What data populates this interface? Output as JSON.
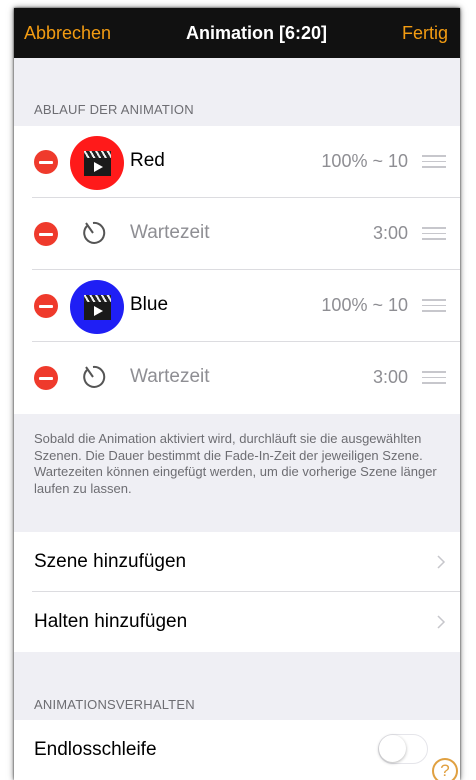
{
  "navbar": {
    "cancel_label": "Abbrechen",
    "title": "Animation [6:20]",
    "done_label": "Fertig",
    "accent_color": "#f39c12"
  },
  "sequence": {
    "header": "ABLAUF DER ANIMATION",
    "items": [
      {
        "type": "scene",
        "label": "Red",
        "value": "100% ~ 10",
        "color": "#ff1a1a",
        "icon": "clapperboard-icon"
      },
      {
        "type": "wait",
        "label": "Wartezeit",
        "value": "3:00",
        "icon": "timer-icon"
      },
      {
        "type": "scene",
        "label": "Blue",
        "value": "100% ~ 10",
        "color": "#1f1ff5",
        "icon": "clapperboard-icon"
      },
      {
        "type": "wait",
        "label": "Wartezeit",
        "value": "3:00",
        "icon": "timer-icon"
      }
    ],
    "footer": "Sobald die Animation aktiviert wird, durchläuft sie die ausgewählten Szenen. Die Dauer bestimmt die Fade-In-Zeit der jeweiligen Szene. Wartezeiten können eingefügt werden, um die vorherige Szene länger laufen zu lassen."
  },
  "actions": {
    "add_scene": "Szene hinzufügen",
    "add_hold": "Halten hinzufügen"
  },
  "behavior": {
    "header": "ANIMATIONSVERHALTEN",
    "loop_label": "Endlosschleife",
    "loop_enabled": false,
    "help_label": "?"
  }
}
